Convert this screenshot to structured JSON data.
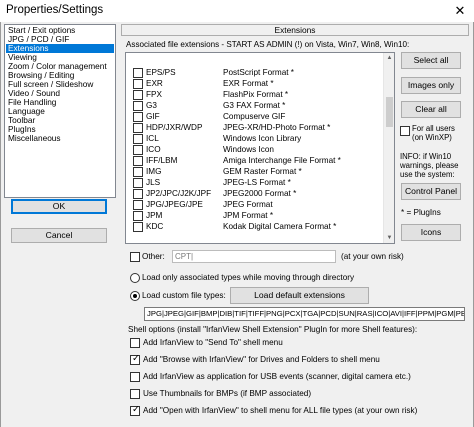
{
  "window": {
    "title": "Properties/Settings",
    "close_glyph": "✕"
  },
  "categories": [
    {
      "label": "Start / Exit options",
      "selected": false
    },
    {
      "label": "JPG / PCD / GIF",
      "selected": false
    },
    {
      "label": "Extensions",
      "selected": true
    },
    {
      "label": "Viewing",
      "selected": false
    },
    {
      "label": "Zoom / Color management",
      "selected": false
    },
    {
      "label": "Browsing / Editing",
      "selected": false
    },
    {
      "label": "Full screen / Slideshow",
      "selected": false
    },
    {
      "label": "Video / Sound",
      "selected": false
    },
    {
      "label": "File Handling",
      "selected": false
    },
    {
      "label": "Language",
      "selected": false
    },
    {
      "label": "Toolbar",
      "selected": false
    },
    {
      "label": "PlugIns",
      "selected": false
    },
    {
      "label": "Miscellaneous",
      "selected": false
    }
  ],
  "footer": {
    "ok_label": "OK",
    "cancel_label": "Cancel"
  },
  "extensions_panel": {
    "header": "Extensions",
    "assoc_label": "Associated file extensions - START AS ADMIN (!) on Vista, Win7, Win8, Win10:",
    "items": [
      {
        "ext": "EPS/PS",
        "desc": "PostScript Format *",
        "checked": false
      },
      {
        "ext": "EXR",
        "desc": "EXR Format *",
        "checked": false
      },
      {
        "ext": "FPX",
        "desc": "FlashPix Format *",
        "checked": false
      },
      {
        "ext": "G3",
        "desc": "G3 FAX Format *",
        "checked": false
      },
      {
        "ext": "GIF",
        "desc": "Compuserve GIF",
        "checked": false
      },
      {
        "ext": "HDP/JXR/WDP",
        "desc": "JPEG-XR/HD-Photo Format *",
        "checked": false
      },
      {
        "ext": "ICL",
        "desc": "Windows Icon Library",
        "checked": false
      },
      {
        "ext": "ICO",
        "desc": "Windows Icon",
        "checked": false
      },
      {
        "ext": "IFF/LBM",
        "desc": "Amiga Interchange File Format *",
        "checked": false
      },
      {
        "ext": "IMG",
        "desc": "GEM Raster Format *",
        "checked": false
      },
      {
        "ext": "JLS",
        "desc": "JPEG-LS Format *",
        "checked": false
      },
      {
        "ext": "JP2/JPC/J2K/JPF",
        "desc": "JPEG2000 Format *",
        "checked": false
      },
      {
        "ext": "JPG/JPEG/JPE",
        "desc": "JPEG Format",
        "checked": false
      },
      {
        "ext": "JPM",
        "desc": "JPM Format *",
        "checked": false
      },
      {
        "ext": "KDC",
        "desc": "Kodak Digital Camera Format *",
        "checked": false
      }
    ],
    "scroll_up_glyph": "▲",
    "scroll_down_glyph": "▼",
    "select_all_label": "Select all",
    "images_only_label": "Images only",
    "clear_all_label": "Clear all",
    "for_all_users_label": "For all users\n(on WinXP)",
    "info_text": "INFO: if Win10\nwarnings, please\nuse the system:",
    "control_panel_label": "Control Panel",
    "plugins_note": "* = PlugIns",
    "icons_label": "Icons",
    "other_label": "Other:",
    "other_value": "CPT|",
    "own_risk_1": "(at your own risk)",
    "radio_assoc_label": "Load only associated types while moving through directory",
    "radio_custom_label": "Load custom file types:",
    "load_default_label": "Load default extensions",
    "custom_types_value": "JPG|JPEG|GIF|BMP|DIB|TIF|TIFF|PNG|PCX|TGA|PCD|SUN|RAS|ICO|AVI|IFF|PPM|PGM|PBM|PSD|WMF|EMF",
    "shell_label": "Shell options (install \"IrfanView Shell Extension\" PlugIn for more Shell features):",
    "shell_items": [
      {
        "label": "Add IrfanView to \"Send To\" shell menu",
        "checked": false
      },
      {
        "label": "Add \"Browse with IrfanView\" for Drives and Folders to shell menu",
        "checked": true
      },
      {
        "label": "Add IrfanView as application for USB events (scanner, digital camera etc.)",
        "checked": false
      },
      {
        "label": "Use Thumbnails for BMPs (if BMP associated)",
        "checked": false
      },
      {
        "label": "Add \"Open with IrfanView\" to shell menu for ALL file types (at your own risk)",
        "checked": true
      }
    ]
  }
}
